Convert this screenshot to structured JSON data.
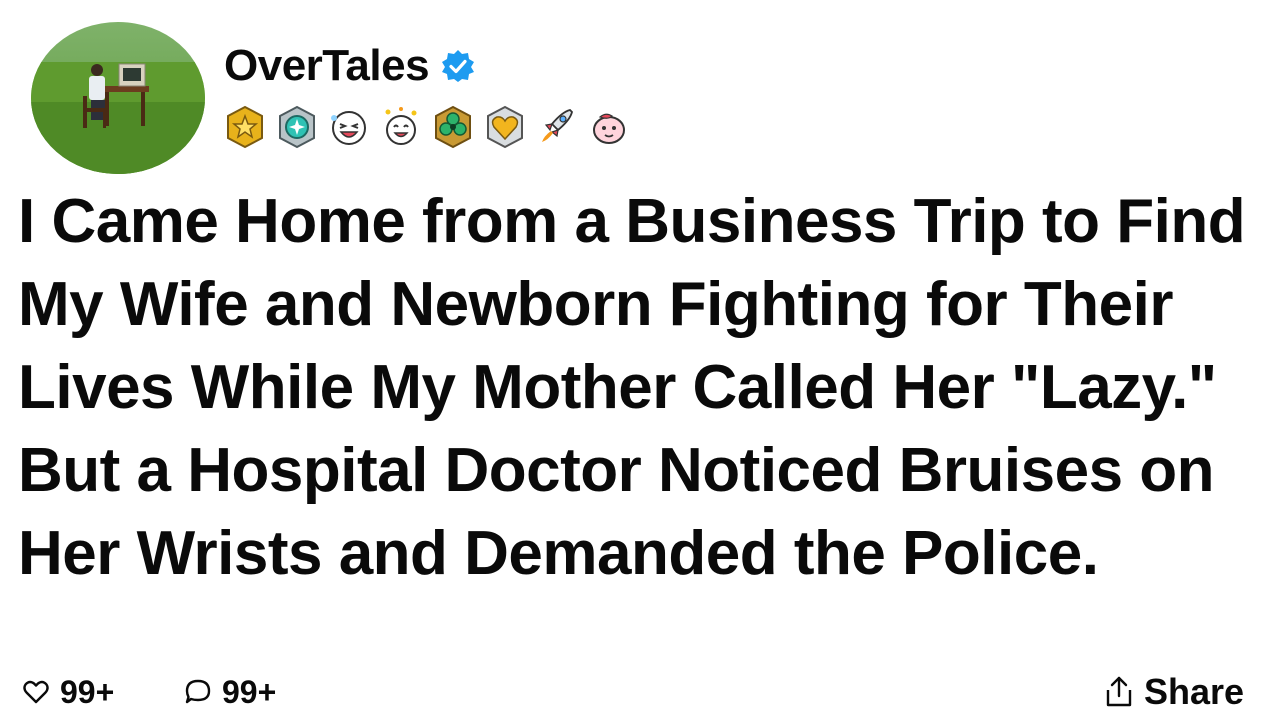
{
  "author": {
    "name": "OverTales",
    "verified": true,
    "accent_color": "#1d9bf0"
  },
  "badges": [
    {
      "icon": "gold-star-badge-icon"
    },
    {
      "icon": "teal-gem-badge-icon"
    },
    {
      "icon": "laughing-face-badge-icon"
    },
    {
      "icon": "celebrating-face-badge-icon"
    },
    {
      "icon": "green-clover-badge-icon"
    },
    {
      "icon": "gold-heart-badge-icon"
    },
    {
      "icon": "rocket-badge-icon"
    },
    {
      "icon": "pink-blob-badge-icon"
    }
  ],
  "post": {
    "title": "I Came Home from a Business Trip to Find My Wife and Newborn Fighting for Their Lives While My Mother Called Her \"Lazy.\" But a Hospital Doctor Noticed Bruises on Her Wrists and Demanded the Police."
  },
  "actions": {
    "likes": "99+",
    "comments": "99+",
    "share_label": "Share"
  }
}
